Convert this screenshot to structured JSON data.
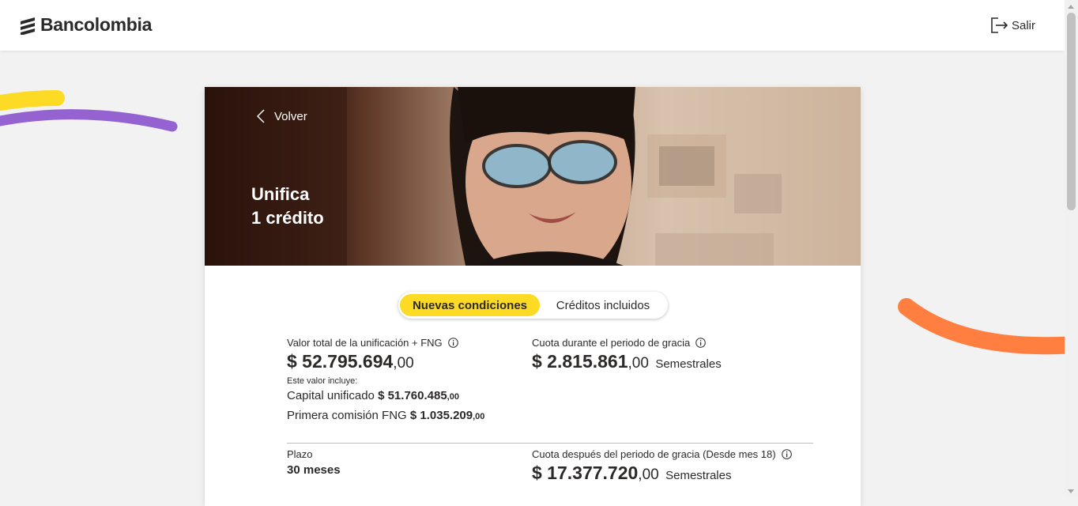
{
  "header": {
    "brand": "Bancolombia",
    "logout_label": "Salir"
  },
  "hero": {
    "back_label": "Volver",
    "title_line1": "Unifica",
    "title_line2": "1 crédito"
  },
  "tabs": [
    {
      "label": "Nuevas condiciones",
      "active": true
    },
    {
      "label": "Créditos incluidos",
      "active": false
    }
  ],
  "summary": {
    "total_label": "Valor total de la unificación + FNG",
    "total_amount": "$ 52.795.694",
    "total_cents": ",00",
    "includes_label": "Este valor incluye:",
    "capital_label": "Capital unificado",
    "capital_amount": "$ 51.760.485",
    "capital_cents": ",00",
    "fng_label": "Primera comisión FNG",
    "fng_amount": "$ 1.035.209",
    "fng_cents": ",00",
    "grace_label": "Cuota durante el periodo de gracia",
    "grace_amount": "$ 2.815.861",
    "grace_cents": ",00",
    "grace_unit": "Semestrales",
    "term_label": "Plazo",
    "term_value": "30 meses",
    "after_label": "Cuota después del periodo de gracia (Desde mes 18)",
    "after_amount": "$ 17.377.720",
    "after_cents": ",00",
    "after_unit": "Semestrales"
  },
  "colors": {
    "accent_yellow": "#fdda24",
    "deco_purple": "#9463d1",
    "deco_orange": "#ff7f41",
    "text_dark": "#2c2a29"
  }
}
